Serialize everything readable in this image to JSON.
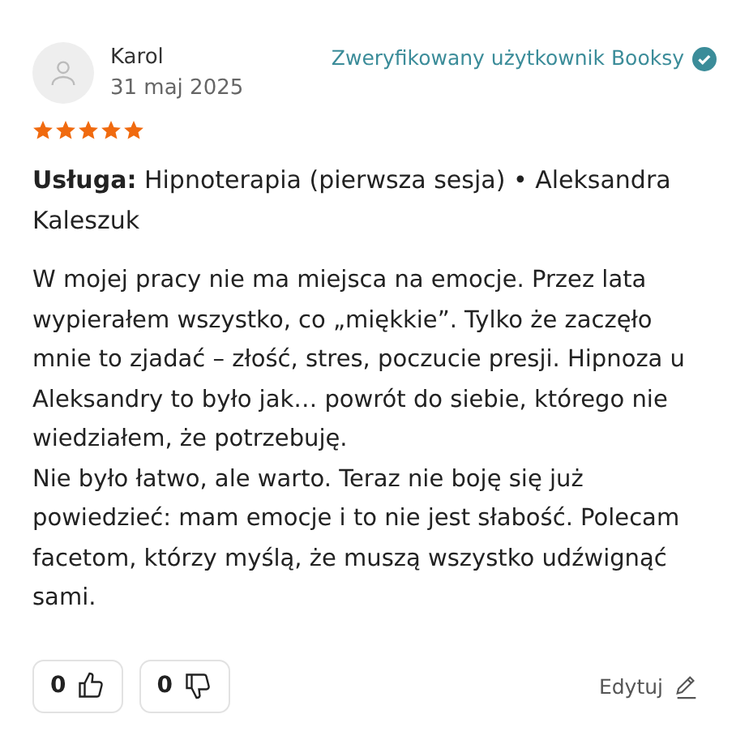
{
  "review": {
    "author": "Karol",
    "date": "31 maj 2025",
    "verified": "Zweryfikowany użytkownik Booksy",
    "stars": 5,
    "service": "**Usługa:** Hipnoterapia (pierwsza sesja) • Aleksandra Kaleszuk",
    "paragraphs": [
      "W mojej pracy nie ma miejsca na emocje. Przez lata wypierałem wszystko, co „miękkie”. Tylko że zaczęło mnie to zjadać – złość, stres, poczucie presji. Hipnoza u Aleksandry to było jak… powrót do siebie, którego nie wiedziałem, że potrzebuję.",
      "Nie było łatwo, ale warto. Teraz nie boję się już powiedzieć: mam emocje i to nie jest słabość. Polecam facetom, którzy myślą, że muszą wszystko udźwignąć sami."
    ],
    "likes": "0",
    "dislikes": "0",
    "edit": "Edytuj"
  }
}
